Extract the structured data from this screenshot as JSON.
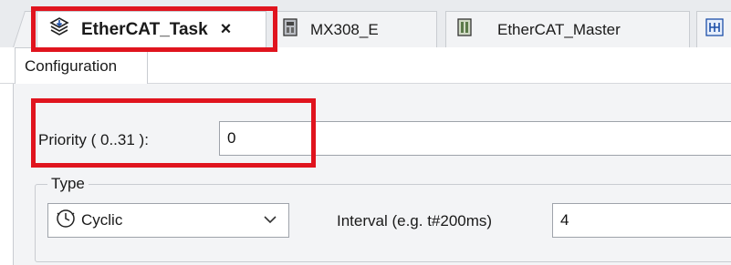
{
  "tabs": [
    {
      "label": "EtherCAT_Task",
      "icon": "task-icon",
      "active": true,
      "closable": true,
      "close_label": "×"
    },
    {
      "label": "MX308_E",
      "icon": "device-icon",
      "active": false
    },
    {
      "label": "EtherCAT_Master",
      "icon": "master-device-icon",
      "active": false
    },
    {
      "label": "",
      "icon": "fieldbus-icon",
      "active": false
    }
  ],
  "subtabs": [
    {
      "label": "Configuration",
      "active": true
    }
  ],
  "priority": {
    "label": "Priority ( 0..31  ):",
    "value": "0"
  },
  "type_group": {
    "title": "Type",
    "selected": "Cyclic",
    "icon": "clock-icon"
  },
  "interval": {
    "label": "Interval (e.g. t#200ms)",
    "value": "4"
  },
  "colors": {
    "highlight": "#e0141e",
    "panel_bg": "#f3f4f6",
    "tabstrip_bg": "#e9ebee"
  }
}
